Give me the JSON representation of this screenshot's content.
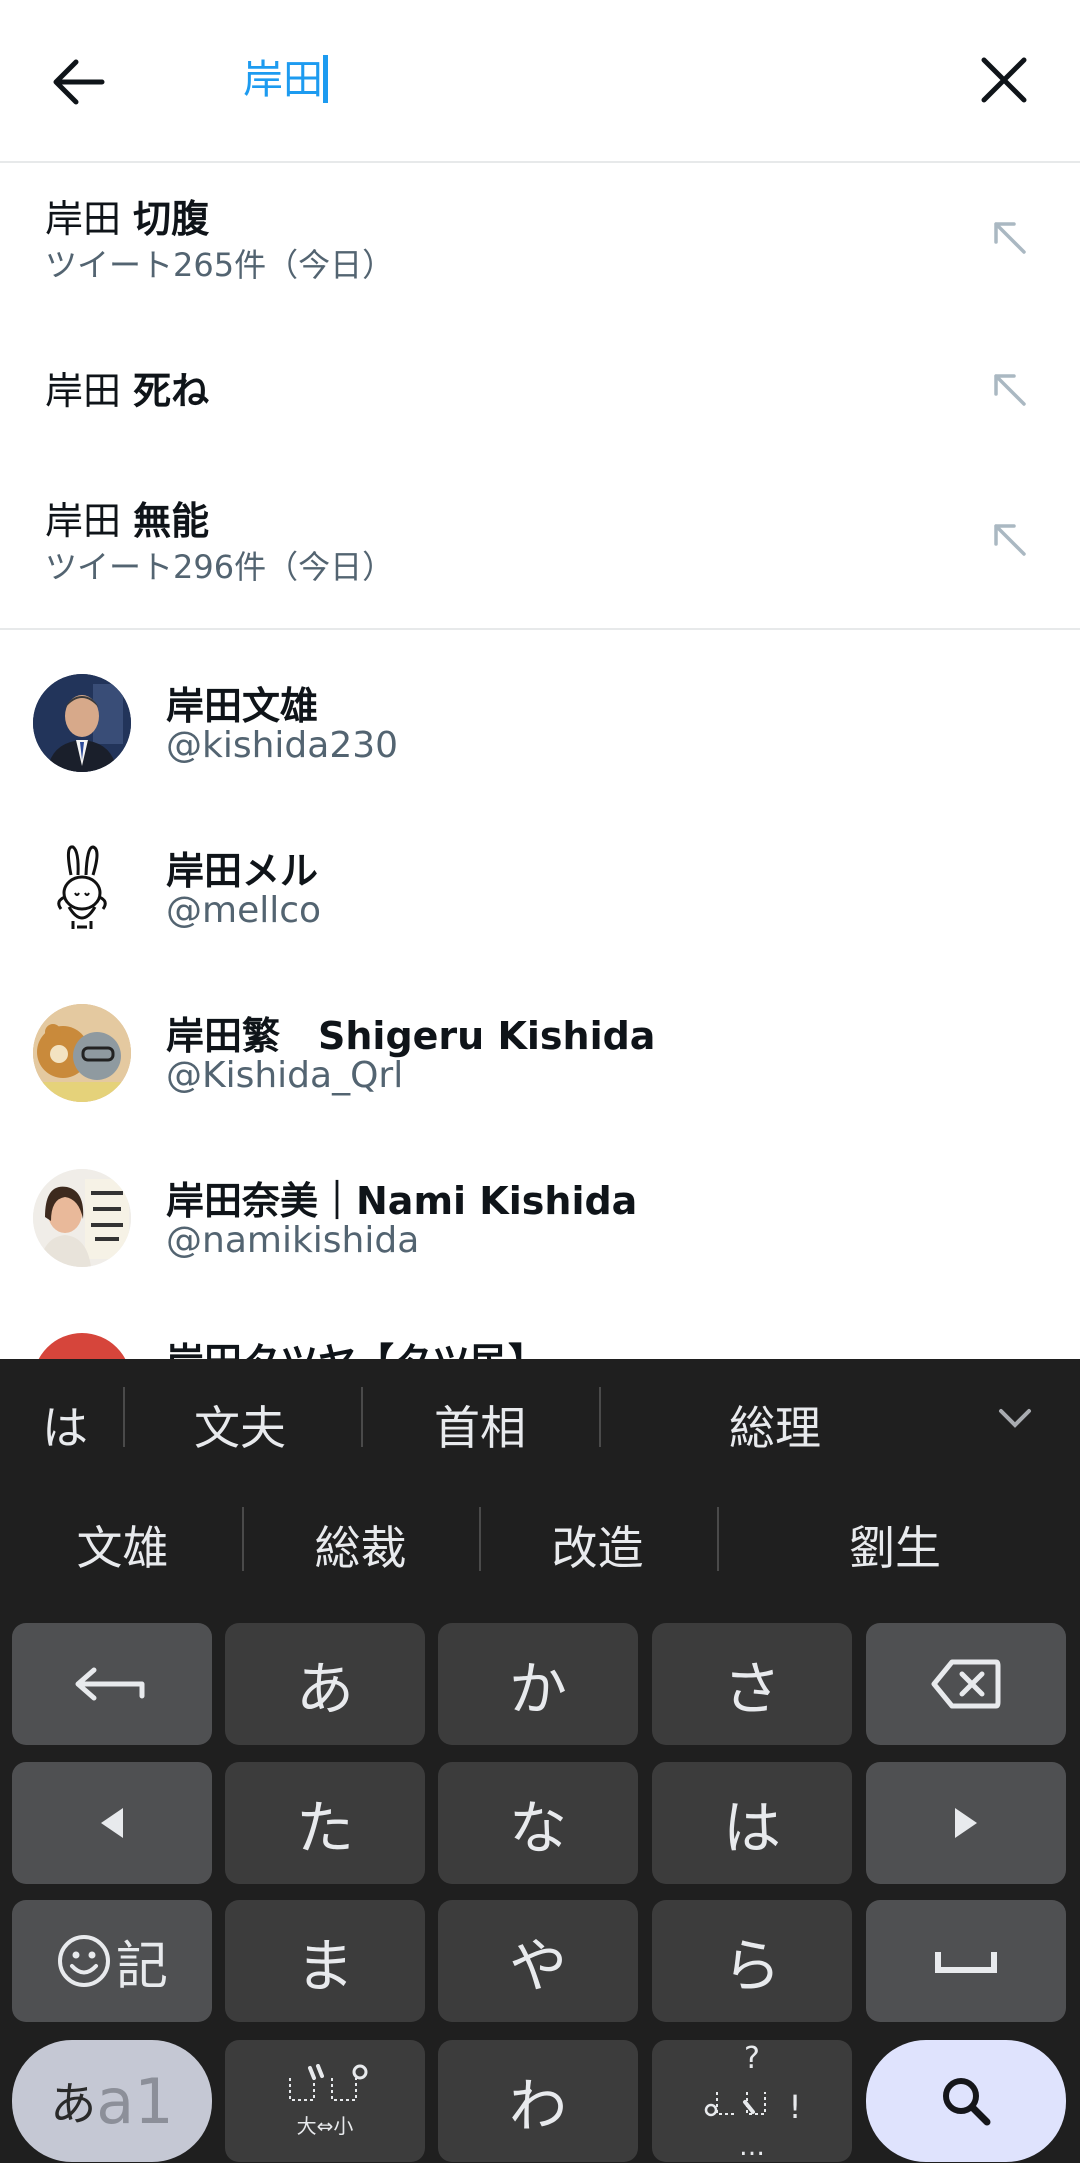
{
  "header": {
    "query": "岸田",
    "back_icon": "arrow-left-icon",
    "clear_icon": "close-icon"
  },
  "suggestions": [
    {
      "word1": "岸田",
      "word2": "切腹",
      "sub": "ツイート265件（今日）"
    },
    {
      "word1": "岸田",
      "word2": "死ね",
      "sub": ""
    },
    {
      "word1": "岸田",
      "word2": "無能",
      "sub": "ツイート296件（今日）"
    }
  ],
  "users": [
    {
      "name": "岸田文雄",
      "handle": "@kishida230"
    },
    {
      "name": "岸田メル",
      "handle": "@mellco"
    },
    {
      "name": "岸田繁　Shigeru Kishida",
      "handle": "@Kishida_Qrl"
    },
    {
      "name": "岸田奈美｜Nami Kishida",
      "handle": "@namikishida"
    },
    {
      "name": "岸田タツヤ【タツ民】",
      "handle": ""
    }
  ],
  "keyboard": {
    "candidates_row1": [
      "は",
      "文夫",
      "首相",
      "総理"
    ],
    "candidates_row2": [
      "文雄",
      "総裁",
      "改造",
      "劉生"
    ],
    "keys": {
      "r1": [
        "undo",
        "あ",
        "か",
        "さ",
        "backspace"
      ],
      "r2": [
        "left",
        "た",
        "な",
        "は",
        "right"
      ],
      "r3": [
        "記",
        "ま",
        "や",
        "ら",
        "space"
      ],
      "r4": [
        "あa1",
        "゛゜",
        "わ",
        "、。?!",
        "search"
      ]
    },
    "mode_label_a": "あ",
    "mode_label_b": "a1",
    "dakuten_small_label": "大⇔小",
    "punct_q": "?",
    "punct_excl": "!",
    "punct_dots": "…",
    "colors": {
      "bg": "#1f1f1f",
      "key": "#3c3c3c",
      "func_key": "#4f5052",
      "search_key": "#dfe3fd"
    }
  }
}
